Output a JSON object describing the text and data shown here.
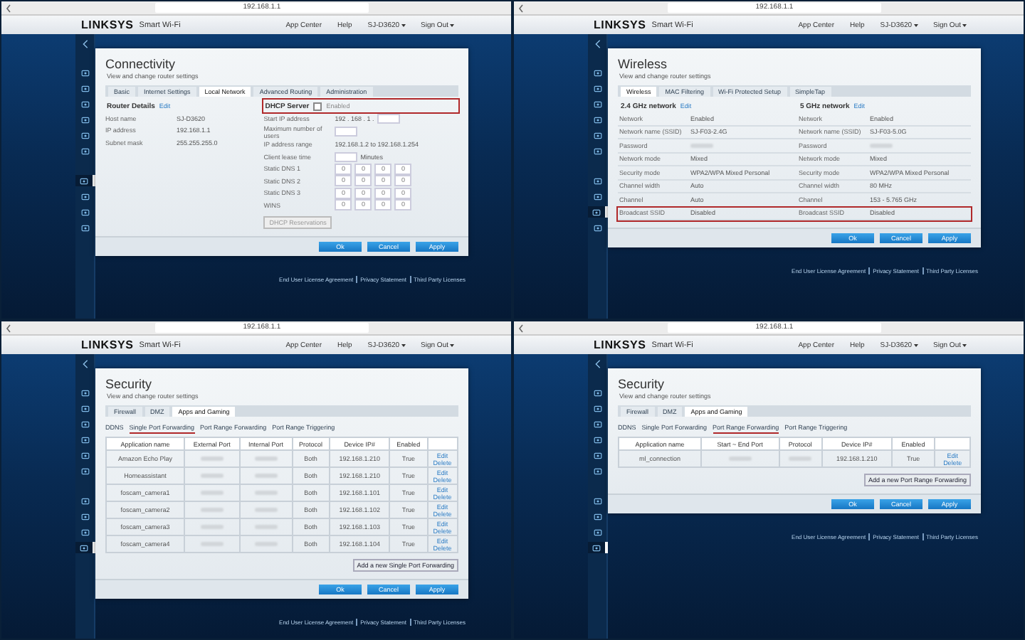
{
  "panels": [
    {
      "url": "192.168.1.1",
      "brand": "LINKSYS",
      "product": "Smart Wi-Fi",
      "nav": [
        {
          "label": "App Center",
          "caret": false
        },
        {
          "label": "Help",
          "caret": false
        },
        {
          "label": "SJ-D3620",
          "caret": true
        },
        {
          "label": "Sign Out",
          "caret": true
        }
      ],
      "sidebar": [
        {
          "selected": false
        },
        {
          "selected": false
        },
        {
          "selected": false
        },
        {
          "selected": false
        },
        {
          "selected": false
        },
        {
          "selected": false
        },
        {
          "selected": true
        },
        {
          "selected": false
        },
        {
          "selected": false
        },
        {
          "selected": false
        }
      ],
      "dialog": {
        "kind": "connectivity",
        "title": "Connectivity",
        "subtitle": "View and change router settings",
        "tabs": [
          {
            "label": "Basic",
            "selected": false
          },
          {
            "label": "Internet Settings",
            "selected": false
          },
          {
            "label": "Local Network",
            "selected": true
          },
          {
            "label": "Advanced Routing",
            "selected": false
          },
          {
            "label": "Administration",
            "selected": false
          }
        ],
        "left": {
          "heading": "Router Details",
          "link": "Edit",
          "rows": [
            {
              "kind": "text",
              "label": "Host name",
              "value": "SJ-D3620"
            },
            {
              "kind": "text",
              "label": "IP address",
              "value": "192.168.1.1"
            },
            {
              "kind": "text",
              "label": "Subnet mask",
              "value": "255.255.255.0"
            }
          ]
        },
        "right": {
          "heading": "DHCP Server",
          "highlighted": true,
          "checkbox": {
            "label": "Enabled",
            "checked": false
          },
          "rows": [
            {
              "kind": "field",
              "label": "Start IP address",
              "prefix": "192 . 168 . 1 ."
            },
            {
              "kind": "field",
              "label": "Maximum number of users"
            },
            {
              "kind": "text",
              "label": "IP address range",
              "value": "192.168.1.2 to 192.168.1.254"
            },
            {
              "kind": "field",
              "label": "Client lease time",
              "suffix": "Minutes"
            },
            {
              "kind": "octets",
              "label": "Static DNS 1",
              "octets": [
                "0",
                "0",
                "0",
                "0"
              ]
            },
            {
              "kind": "octets",
              "label": "Static DNS 2",
              "octets": [
                "0",
                "0",
                "0",
                "0"
              ]
            },
            {
              "kind": "octets",
              "label": "Static DNS 3",
              "octets": [
                "0",
                "0",
                "0",
                "0"
              ]
            },
            {
              "kind": "octets",
              "label": "WINS",
              "octets": [
                "0",
                "0",
                "0",
                "0"
              ]
            }
          ],
          "button": {
            "label": "DHCP Reservations",
            "disabled": true
          }
        },
        "buttons": [
          "Ok",
          "Cancel",
          "Apply"
        ]
      },
      "footer_links": [
        "End User License Agreement",
        "Privacy Statement",
        "Third Party Licenses"
      ]
    },
    {
      "url": "192.168.1.1",
      "brand": "LINKSYS",
      "product": "Smart Wi-Fi",
      "nav": [
        {
          "label": "App Center",
          "caret": false
        },
        {
          "label": "Help",
          "caret": false
        },
        {
          "label": "SJ-D3620",
          "caret": true
        },
        {
          "label": "Sign Out",
          "caret": true
        }
      ],
      "sidebar": [
        {
          "selected": false
        },
        {
          "selected": false
        },
        {
          "selected": false
        },
        {
          "selected": false
        },
        {
          "selected": false
        },
        {
          "selected": false
        },
        {
          "selected": false
        },
        {
          "selected": false
        },
        {
          "selected": true
        },
        {
          "selected": false
        }
      ],
      "dialog": {
        "kind": "wireless",
        "title": "Wireless",
        "subtitle": "View and change router settings",
        "tabs": [
          {
            "label": "Wireless",
            "selected": true
          },
          {
            "label": "MAC Filtering",
            "selected": false
          },
          {
            "label": "Wi-Fi Protected Setup",
            "selected": false
          },
          {
            "label": "SimpleTap",
            "selected": false
          }
        ],
        "columns": [
          {
            "heading": "2.4 GHz network",
            "link": "Edit"
          },
          {
            "heading": "5 GHz network",
            "link": "Edit"
          }
        ],
        "rows": [
          {
            "highlighted": false,
            "cells": [
              {
                "label": "Network",
                "value": "Enabled",
                "hidden": false
              },
              {
                "label": "Network",
                "value": "Enabled",
                "hidden": false
              }
            ]
          },
          {
            "highlighted": false,
            "cells": [
              {
                "label": "Network name (SSID)",
                "value": "SJ-F03-2.4G",
                "hidden": false
              },
              {
                "label": "Network name (SSID)",
                "value": "SJ-F03-5.0G",
                "hidden": false
              }
            ]
          },
          {
            "highlighted": false,
            "cells": [
              {
                "label": "Password",
                "hidden": true
              },
              {
                "label": "Password",
                "hidden": true
              }
            ]
          },
          {
            "highlighted": false,
            "cells": [
              {
                "label": "Network mode",
                "value": "Mixed",
                "hidden": false
              },
              {
                "label": "Network mode",
                "value": "Mixed",
                "hidden": false
              }
            ]
          },
          {
            "highlighted": false,
            "cells": [
              {
                "label": "Security mode",
                "value": "WPA2/WPA Mixed Personal",
                "hidden": false
              },
              {
                "label": "Security mode",
                "value": "WPA2/WPA Mixed Personal",
                "hidden": false
              }
            ]
          },
          {
            "highlighted": false,
            "cells": [
              {
                "label": "Channel width",
                "value": "Auto",
                "hidden": false
              },
              {
                "label": "Channel width",
                "value": "80 MHz",
                "hidden": false
              }
            ]
          },
          {
            "highlighted": false,
            "cells": [
              {
                "label": "Channel",
                "value": "Auto",
                "hidden": false
              },
              {
                "label": "Channel",
                "value": "153 - 5.765 GHz",
                "hidden": false
              }
            ]
          },
          {
            "highlighted": true,
            "cells": [
              {
                "label": "Broadcast SSID",
                "value": "Disabled",
                "hidden": false
              },
              {
                "label": "Broadcast SSID",
                "value": "Disabled",
                "hidden": false
              }
            ]
          }
        ],
        "buttons": [
          "Ok",
          "Cancel",
          "Apply"
        ]
      },
      "footer_links": [
        "End User License Agreement",
        "Privacy Statement",
        "Third Party Licenses"
      ]
    },
    {
      "url": "192.168.1.1",
      "brand": "LINKSYS",
      "product": "Smart Wi-Fi",
      "nav": [
        {
          "label": "App Center",
          "caret": false
        },
        {
          "label": "Help",
          "caret": false
        },
        {
          "label": "SJ-D3620",
          "caret": true
        },
        {
          "label": "Sign Out",
          "caret": true
        }
      ],
      "sidebar": [
        {
          "selected": false
        },
        {
          "selected": false
        },
        {
          "selected": false
        },
        {
          "selected": false
        },
        {
          "selected": false
        },
        {
          "selected": false
        },
        {
          "selected": false
        },
        {
          "selected": false
        },
        {
          "selected": false
        },
        {
          "selected": true
        }
      ],
      "dialog": {
        "kind": "table",
        "title": "Security",
        "subtitle": "View and change router settings",
        "tabs": [
          {
            "label": "Firewall",
            "selected": false
          },
          {
            "label": "DMZ",
            "selected": false
          },
          {
            "label": "Apps and Gaming",
            "selected": true
          }
        ],
        "subtabs": [
          {
            "label": "DDNS",
            "selected": false
          },
          {
            "label": "Single Port Forwarding",
            "selected": true
          },
          {
            "label": "Port Range Forwarding",
            "selected": false
          },
          {
            "label": "Port Range Triggering",
            "selected": false
          }
        ],
        "columns": [
          "Application name",
          "External Port",
          "Internal Port",
          "Protocol",
          "Device IP#",
          "Enabled"
        ],
        "rows": [
          {
            "cells": [
              {
                "text": "Amazon Echo Play",
                "hidden": false
              },
              {
                "hidden": true
              },
              {
                "hidden": true
              },
              {
                "text": "Both",
                "hidden": false
              },
              {
                "text": "192.168.1.210",
                "hidden": false
              },
              {
                "text": "True",
                "hidden": false
              }
            ],
            "actions": [
              "Edit",
              "Delete"
            ]
          },
          {
            "cells": [
              {
                "text": "Homeassistant",
                "hidden": false
              },
              {
                "hidden": true
              },
              {
                "hidden": true
              },
              {
                "text": "Both",
                "hidden": false
              },
              {
                "text": "192.168.1.210",
                "hidden": false
              },
              {
                "text": "True",
                "hidden": false
              }
            ],
            "actions": [
              "Edit",
              "Delete"
            ]
          },
          {
            "cells": [
              {
                "text": "foscam_camera1",
                "hidden": false
              },
              {
                "hidden": true
              },
              {
                "hidden": true
              },
              {
                "text": "Both",
                "hidden": false
              },
              {
                "text": "192.168.1.101",
                "hidden": false
              },
              {
                "text": "True",
                "hidden": false
              }
            ],
            "actions": [
              "Edit",
              "Delete"
            ]
          },
          {
            "cells": [
              {
                "text": "foscam_camera2",
                "hidden": false
              },
              {
                "hidden": true
              },
              {
                "hidden": true
              },
              {
                "text": "Both",
                "hidden": false
              },
              {
                "text": "192.168.1.102",
                "hidden": false
              },
              {
                "text": "True",
                "hidden": false
              }
            ],
            "actions": [
              "Edit",
              "Delete"
            ]
          },
          {
            "cells": [
              {
                "text": "foscam_camera3",
                "hidden": false
              },
              {
                "hidden": true
              },
              {
                "hidden": true
              },
              {
                "text": "Both",
                "hidden": false
              },
              {
                "text": "192.168.1.103",
                "hidden": false
              },
              {
                "text": "True",
                "hidden": false
              }
            ],
            "actions": [
              "Edit",
              "Delete"
            ]
          },
          {
            "cells": [
              {
                "text": "foscam_camera4",
                "hidden": false
              },
              {
                "hidden": true
              },
              {
                "hidden": true
              },
              {
                "text": "Both",
                "hidden": false
              },
              {
                "text": "192.168.1.104",
                "hidden": false
              },
              {
                "text": "True",
                "hidden": false
              }
            ],
            "actions": [
              "Edit",
              "Delete"
            ]
          }
        ],
        "add_button": "Add a new Single Port Forwarding",
        "buttons": [
          "Ok",
          "Cancel",
          "Apply"
        ]
      },
      "footer_links": [
        "End User License Agreement",
        "Privacy Statement",
        "Third Party Licenses"
      ]
    },
    {
      "url": "192.168.1.1",
      "brand": "LINKSYS",
      "product": "Smart Wi-Fi",
      "nav": [
        {
          "label": "App Center",
          "caret": false
        },
        {
          "label": "Help",
          "caret": false
        },
        {
          "label": "SJ-D3620",
          "caret": true
        },
        {
          "label": "Sign Out",
          "caret": true
        }
      ],
      "sidebar": [
        {
          "selected": false
        },
        {
          "selected": false
        },
        {
          "selected": false
        },
        {
          "selected": false
        },
        {
          "selected": false
        },
        {
          "selected": false
        },
        {
          "selected": false
        },
        {
          "selected": false
        },
        {
          "selected": false
        },
        {
          "selected": true
        }
      ],
      "dialog": {
        "kind": "table",
        "title": "Security",
        "subtitle": "View and change router settings",
        "tabs": [
          {
            "label": "Firewall",
            "selected": false
          },
          {
            "label": "DMZ",
            "selected": false
          },
          {
            "label": "Apps and Gaming",
            "selected": true
          }
        ],
        "subtabs": [
          {
            "label": "DDNS",
            "selected": false
          },
          {
            "label": "Single Port Forwarding",
            "selected": false
          },
          {
            "label": "Port Range Forwarding",
            "selected": true
          },
          {
            "label": "Port Range Triggering",
            "selected": false
          }
        ],
        "columns": [
          "Application name",
          "Start ~ End Port",
          "Protocol",
          "Device IP#",
          "Enabled"
        ],
        "rows": [
          {
            "cells": [
              {
                "text": "ml_connection",
                "hidden": false
              },
              {
                "hidden": true
              },
              {
                "hidden": true
              },
              {
                "text": "192.168.1.210",
                "hidden": false
              },
              {
                "text": "True",
                "hidden": false
              }
            ],
            "actions": [
              "Edit",
              "Delete"
            ]
          }
        ],
        "add_button": "Add a new Port Range Forwarding",
        "buttons": [
          "Ok",
          "Cancel",
          "Apply"
        ]
      },
      "footer_links": [
        "End User License Agreement",
        "Privacy Statement",
        "Third Party Licenses"
      ]
    }
  ]
}
